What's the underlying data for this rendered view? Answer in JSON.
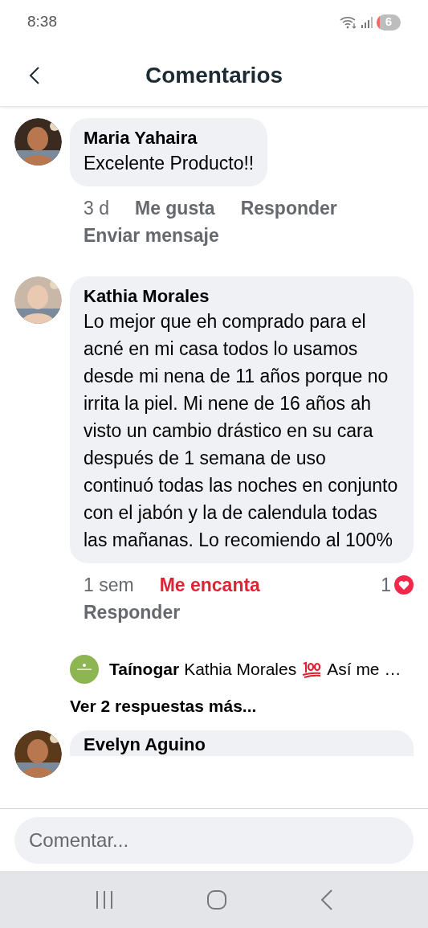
{
  "status_bar": {
    "time": "8:38",
    "battery": "6"
  },
  "header": {
    "title": "Comentarios"
  },
  "comments": [
    {
      "author": "Maria Yahaira",
      "text": "Excelente Producto!!",
      "time": "3 d",
      "like_label": "Me gusta",
      "reacted": false,
      "reply_label": "Responder",
      "message_label": "Enviar mensaje"
    },
    {
      "author": "Kathia Morales",
      "text": "Lo mejor que eh comprado para el acné en mi casa todos lo usamos desde mi nena de 11 años porque no irrita la piel. Mi nene de 16 años ah visto un cambio drástico en su cara después de 1 semana de uso continuó todas las noches en conjunto con el jabón y la de calendula todas las mañanas. Lo recomiendo al 100%",
      "time": "1 sem",
      "like_label": "Me encanta",
      "reacted": true,
      "reply_label": "Responder",
      "reaction_count": "1",
      "reply_preview": {
        "author": "Taínogar",
        "text_before": "Kathia Morales",
        "text_after": "Así me …"
      },
      "more_replies": "Ver 2 respuestas más..."
    },
    {
      "author": "Evelyn Aguino"
    }
  ],
  "composer": {
    "placeholder": "Comentar..."
  }
}
